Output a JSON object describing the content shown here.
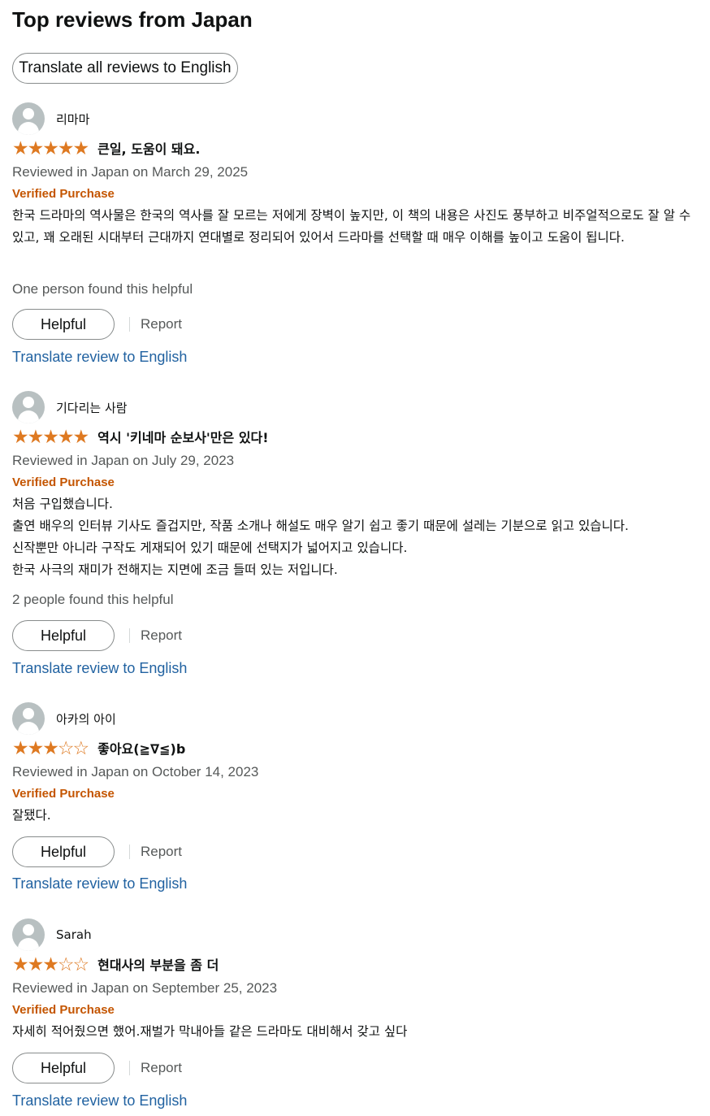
{
  "section": {
    "title": "Top reviews from Japan",
    "translate_all_label": "Translate all reviews to English"
  },
  "labels": {
    "helpful_button": "Helpful",
    "report_link": "Report",
    "translate_review": "Translate review to English",
    "verified": "Verified Purchase"
  },
  "colors": {
    "star": "#de7921",
    "verified": "#c45500",
    "link": "#2162a1",
    "meta_text": "#565959"
  },
  "reviews": [
    {
      "reviewer": "리마마",
      "rating": 5,
      "stars_text": "★★★★★",
      "title": "큰일, 도움이 돼요.",
      "date": "Reviewed in Japan on March 29, 2025",
      "verified": "Verified Purchase",
      "body": [
        "한국 드라마의 역사물은 한국의 역사를 잘 모르는 저에게 장벽이 높지만, 이 책의 내용은 사진도 풍부하고 비주얼적으로도 잘 알 수 있고, 꽤 오래된 시대부터 근대까지 연대별로 정리되어 있어서 드라마를 선택할 때 매우 이해를 높이고 도움이 됩니다."
      ],
      "helpful_count": "One person found this helpful"
    },
    {
      "reviewer": "기다리는 사람",
      "rating": 5,
      "stars_text": "★★★★★",
      "title": "역시 '키네마 순보사'만은 있다!",
      "date": "Reviewed in Japan on July 29, 2023",
      "verified": "Verified Purchase",
      "body": [
        "처음 구입했습니다.",
        "출연 배우의 인터뷰 기사도 즐겁지만, 작품 소개나 해설도 매우 알기 쉽고 좋기 때문에 설레는 기분으로 읽고 있습니다.",
        "신작뿐만 아니라 구작도 게재되어 있기 때문에 선택지가 넓어지고 있습니다.",
        "한국 사극의 재미가 전해지는 지면에 조금 들떠 있는 저입니다."
      ],
      "helpful_count": "2 people found this helpful"
    },
    {
      "reviewer": "아카의 아이",
      "rating": 3,
      "stars_text": "★★★☆☆",
      "title": "좋아요(≧∇≦)b",
      "date": "Reviewed in Japan on October 14, 2023",
      "verified": "Verified Purchase",
      "body": [
        "잘됐다."
      ],
      "helpful_count": ""
    },
    {
      "reviewer": "Sarah",
      "rating": 3,
      "stars_text": "★★★☆☆",
      "title": "현대사의 부분을 좀 더",
      "date": "Reviewed in Japan on September 25, 2023",
      "verified": "Verified Purchase",
      "body": [
        "자세히 적어줬으면 했어.재벌가 막내아들 같은 드라마도 대비해서 갖고 싶다"
      ],
      "helpful_count": ""
    }
  ]
}
